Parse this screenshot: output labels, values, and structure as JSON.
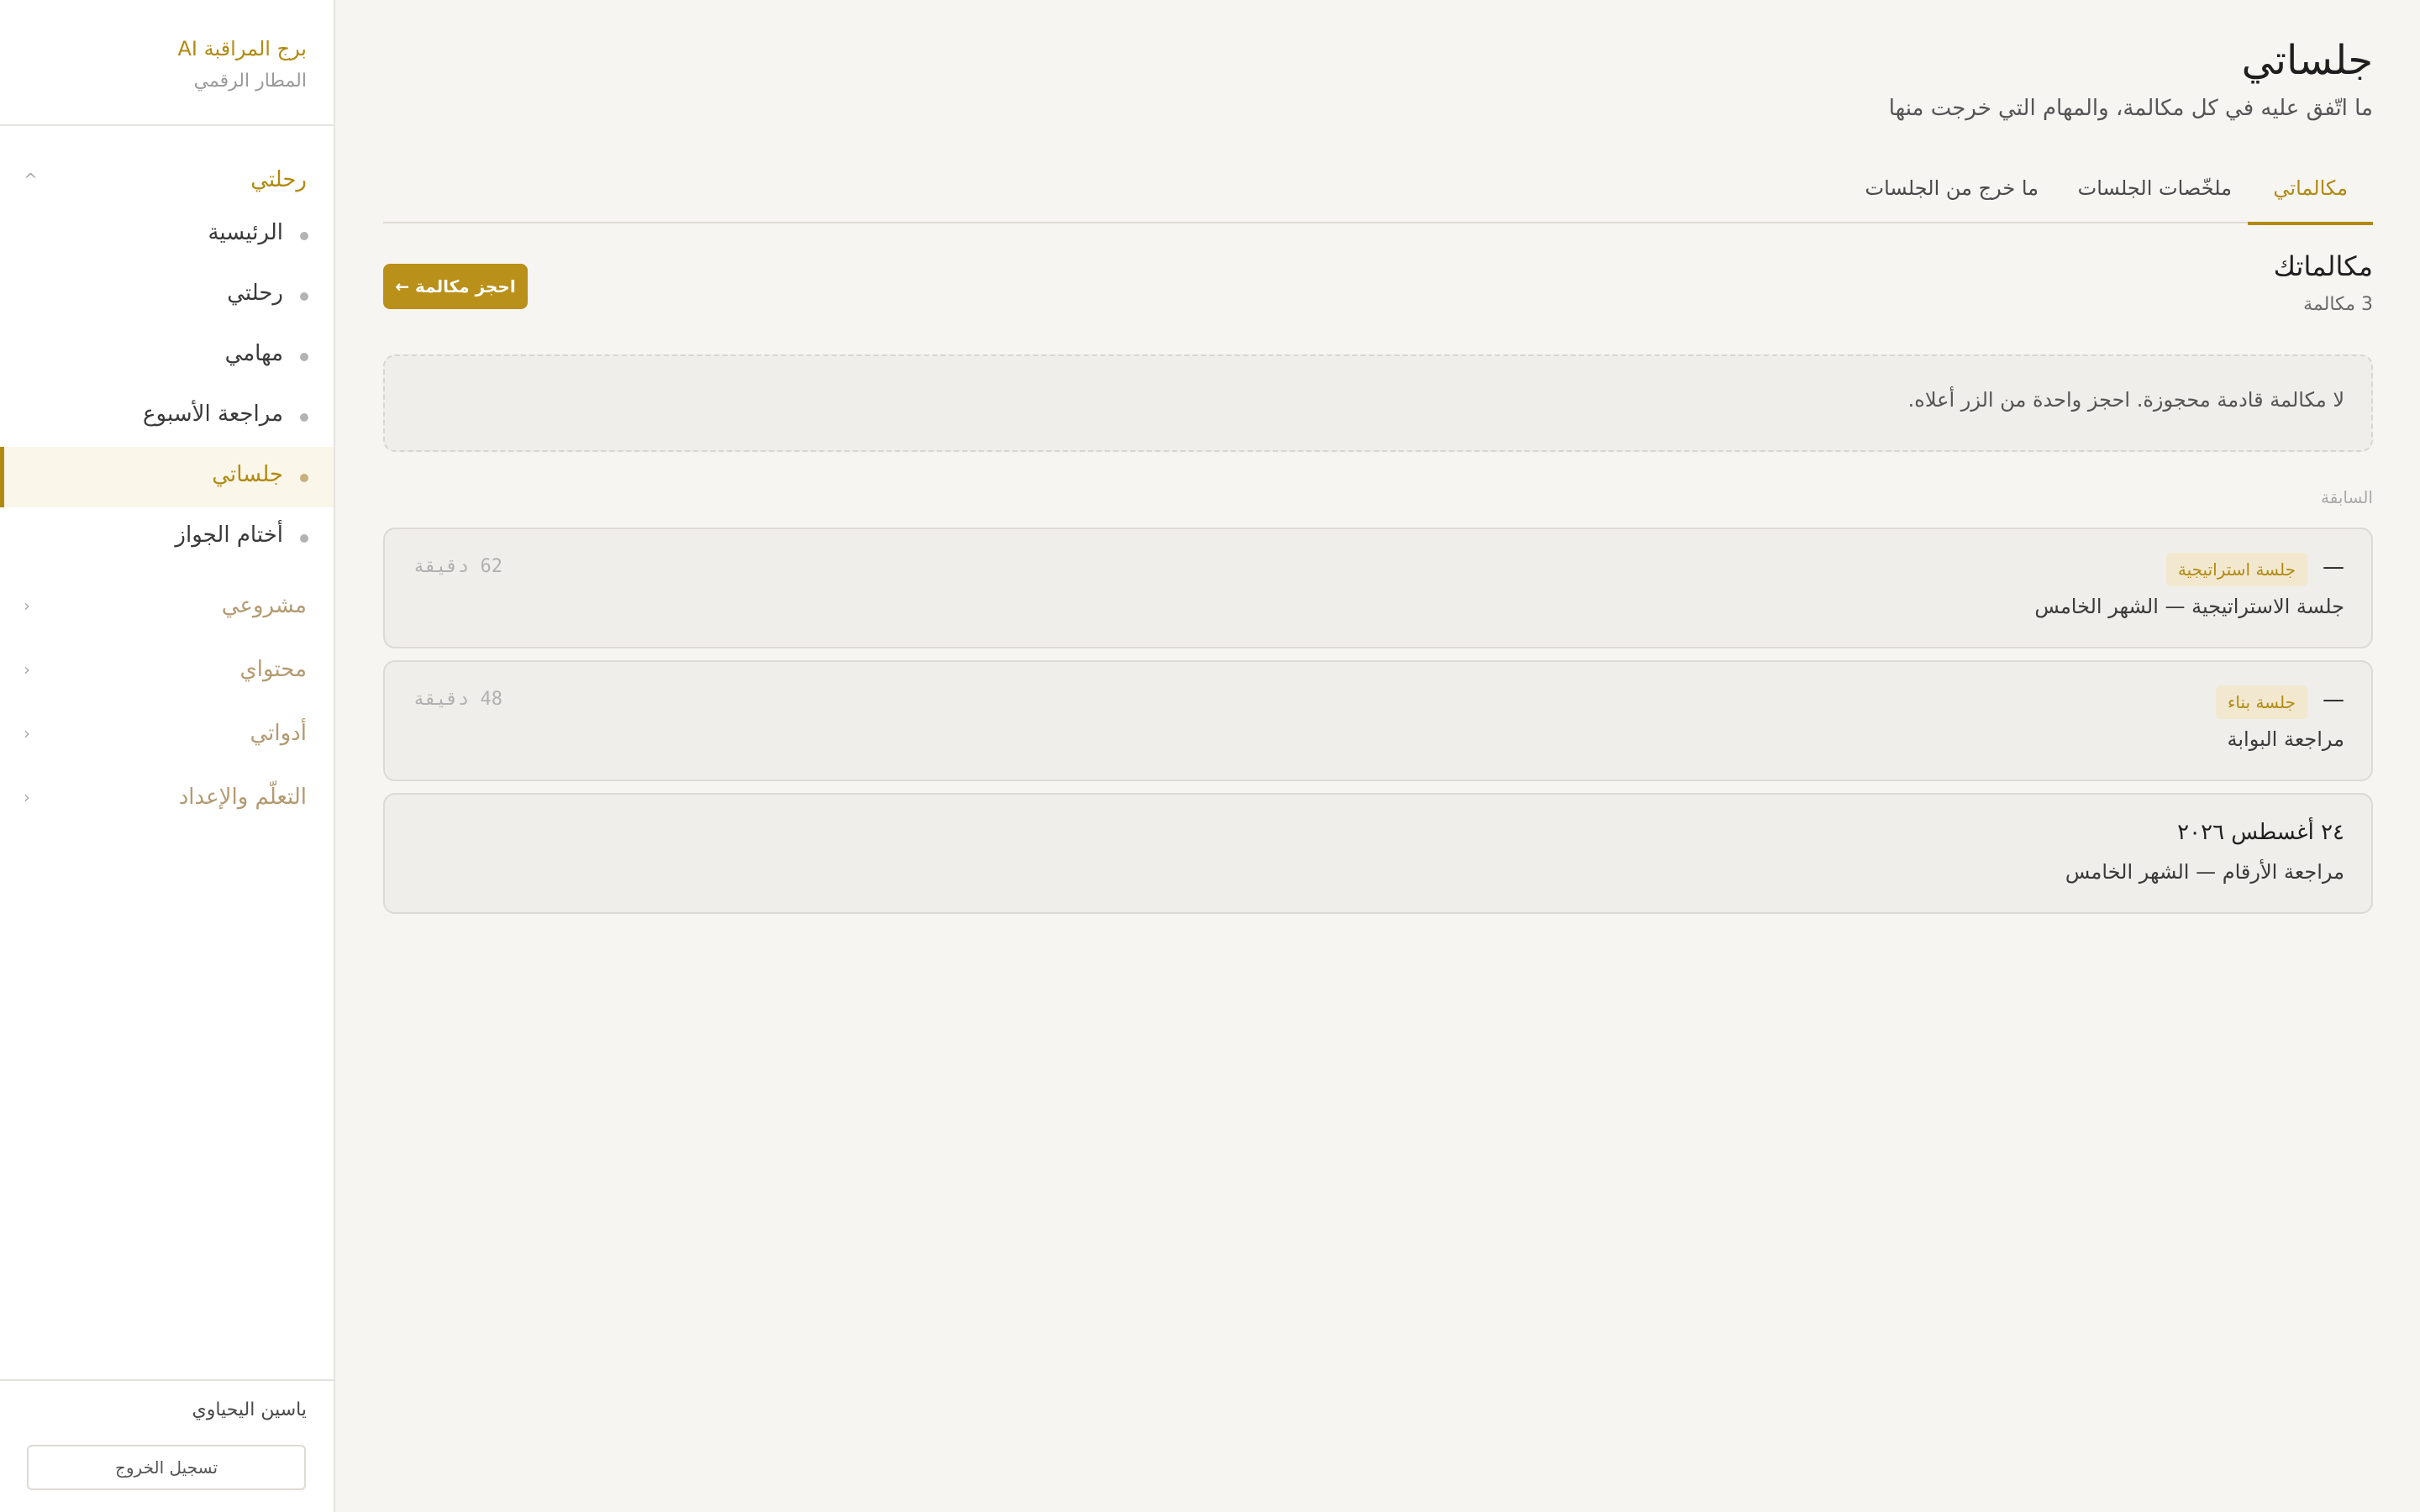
{
  "brand": {
    "title": "برج المراقبة AI",
    "subtitle": "المطار الرقمي"
  },
  "nav": {
    "journey_group": {
      "label": "رحلتي",
      "chevron": "^"
    },
    "items": [
      {
        "label": "الرئيسية"
      },
      {
        "label": "رحلتي"
      },
      {
        "label": "مهامي"
      },
      {
        "label": "مراجعة الأسبوع"
      },
      {
        "label": "جلساتي"
      },
      {
        "label": "أختام الجواز"
      }
    ],
    "groups": [
      {
        "label": "مشروعي",
        "chevron": "‹"
      },
      {
        "label": "محتواي",
        "chevron": "‹"
      },
      {
        "label": "أدواتي",
        "chevron": "‹"
      },
      {
        "label": "التعلّم والإعداد",
        "chevron": "‹"
      }
    ]
  },
  "user": {
    "name": "ياسين اليحياوي",
    "logout_label": "تسجيل الخروج"
  },
  "page": {
    "title": "جلساتي",
    "subtitle": "ما اتّفق عليه في كل مكالمة، والمهام التي خرجت منها"
  },
  "tabs": [
    {
      "label": "مكالماتي",
      "active": true
    },
    {
      "label": "ملخّصات الجلسات",
      "active": false
    },
    {
      "label": "ما خرج من الجلسات",
      "active": false
    }
  ],
  "calls": {
    "title": "مكالماتك",
    "count": "3 مكالمة",
    "book_label": "احجز مكالمة ←",
    "empty_text": "لا مكالمة قادمة محجوزة. احجز واحدة من الزر أعلاه.",
    "previous_label": "السابقة",
    "previous": [
      {
        "dash": "—",
        "badge": "جلسة استراتيجية",
        "title": "جلسة الاستراتيجية — الشهر الخامس",
        "duration": "62 دقيقة"
      },
      {
        "dash": "—",
        "badge": "جلسة بناء",
        "title": "مراجعة البوابة",
        "duration": "48 دقيقة"
      },
      {
        "date": "٢٤ أغسطس ٢٠٢٦",
        "title": "مراجعة الأرقام — الشهر الخامس"
      }
    ]
  },
  "colors": {
    "accent": "#b28a12",
    "button": "#b8901a",
    "background": "#f6f5f2"
  }
}
